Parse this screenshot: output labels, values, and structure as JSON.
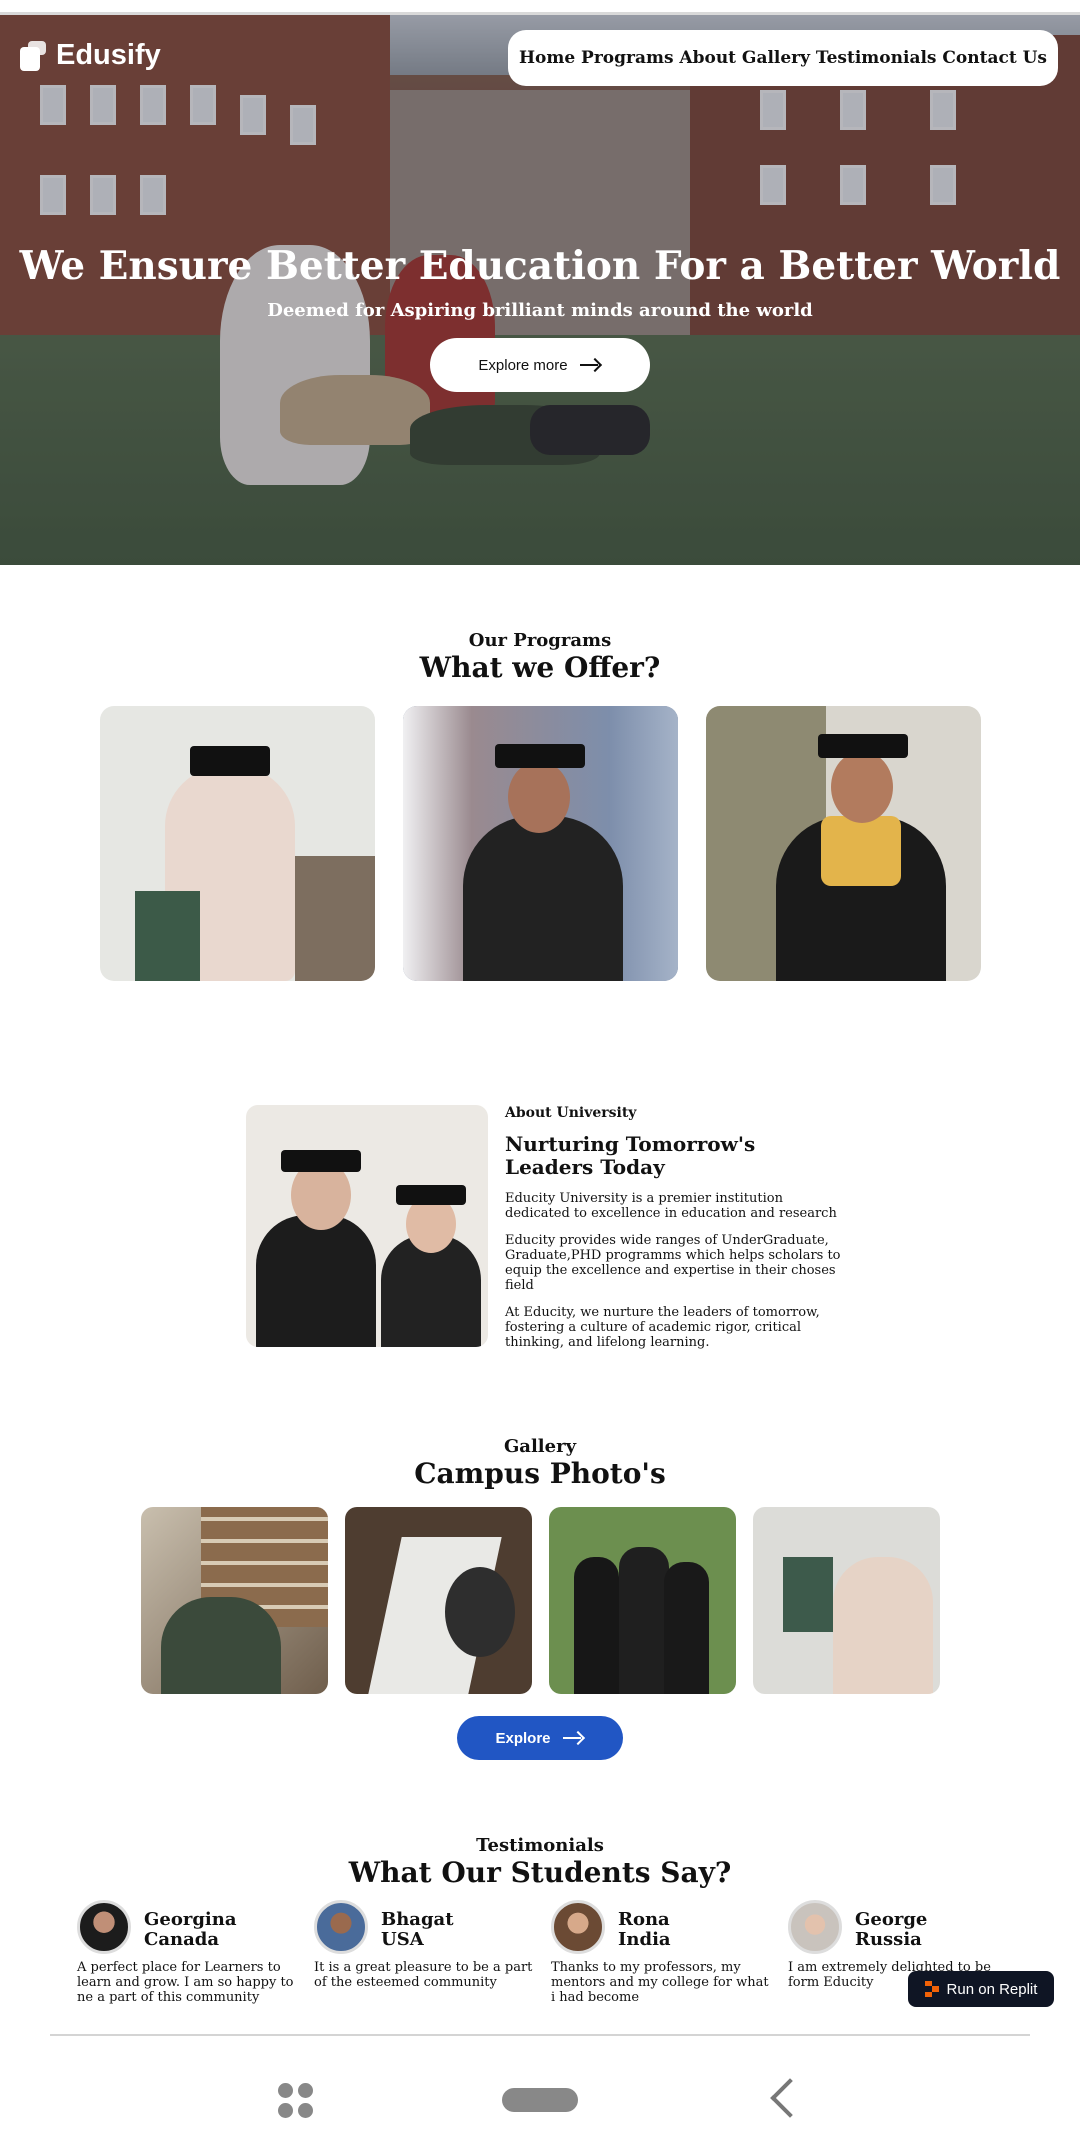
{
  "header": {
    "logo_text": "Edusify",
    "nav": [
      "Home",
      "Programs",
      "About",
      "Gallery",
      "Testimonials",
      "Contact Us"
    ]
  },
  "hero": {
    "title": "We Ensure Better Education For a Better World",
    "subtitle": "Deemed for Aspiring brilliant minds around the world",
    "button_label": "Explore more"
  },
  "programs": {
    "label": "Our Programs",
    "title": "What we Offer?"
  },
  "about": {
    "label": "About University",
    "title": "Nurturing Tomorrow's Leaders Today",
    "paragraphs": [
      "Educity University is a premier institution dedicated to excellence in education and research",
      "Educity provides wide ranges of UnderGraduate, Graduate,PHD programms which helps scholars to equip the excellence and expertise in their choses field",
      "At Educity, we nurture the leaders of tomorrow, fostering a culture of academic rigor, critical thinking, and lifelong learning."
    ]
  },
  "gallery": {
    "label": "Gallery",
    "title": "Campus Photo's",
    "button_label": "Explore"
  },
  "testimonials": {
    "label": "Testimonials",
    "title": "What Our Students Say?",
    "items": [
      {
        "name": "Georgina",
        "place": "Canada",
        "quote": "A perfect place for Learners to learn and grow. I am so happy to ne a part of this community"
      },
      {
        "name": "Bhagat",
        "place": "USA",
        "quote": "It is a great pleasure to be a part of the esteemed community"
      },
      {
        "name": "Rona",
        "place": "India",
        "quote": "Thanks to my professors, my mentors and my college for what i had become"
      },
      {
        "name": "George",
        "place": "Russia",
        "quote": "I am extremely delighted to be form Educity"
      }
    ]
  },
  "replit_badge": "Run on Replit",
  "colors": {
    "accent_blue": "#2156c4",
    "replit_orange": "#f26207",
    "badge_dark": "#0f1524"
  }
}
